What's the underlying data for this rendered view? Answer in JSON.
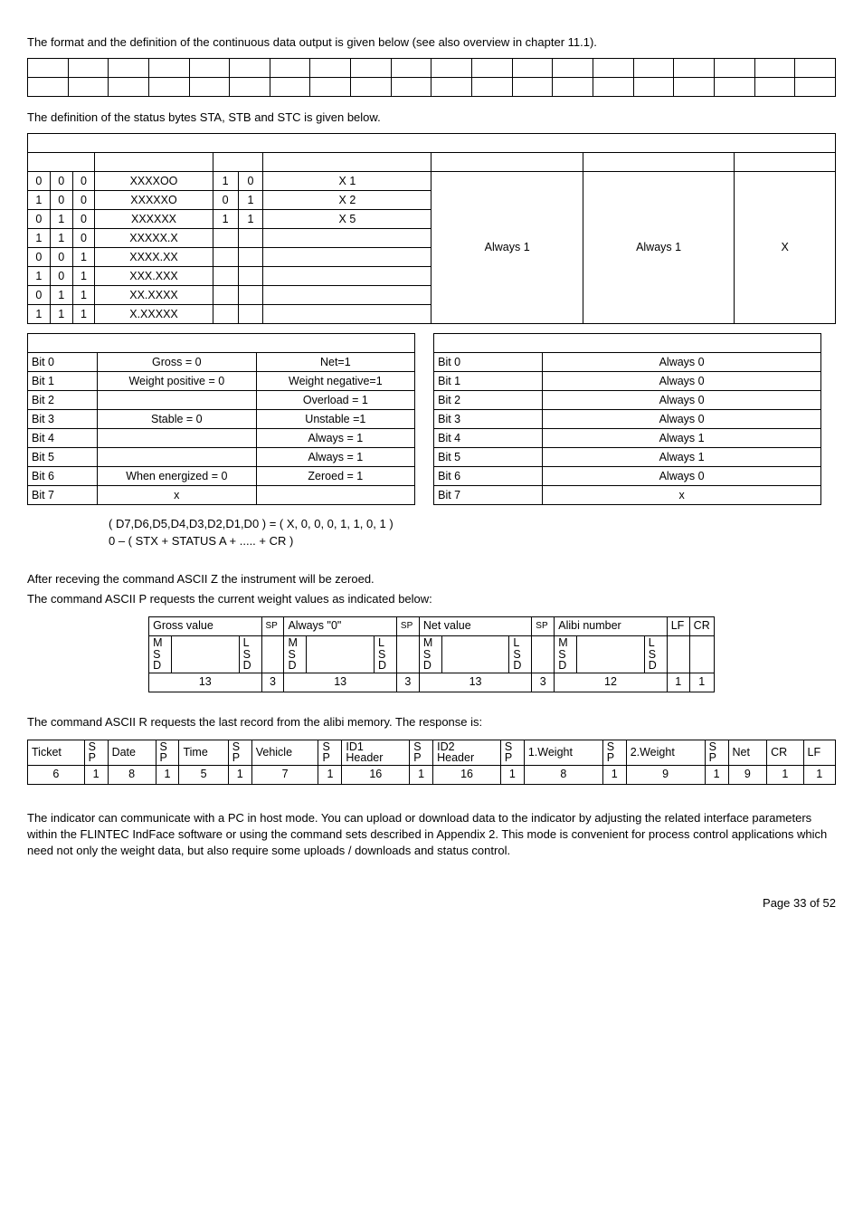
{
  "intro1": "The format and the definition of the continuous data output is given below (see also overview in chapter 11.1).",
  "intro2": "The definition of the status bytes STA, STB and STC is given below.",
  "status_rows": [
    [
      "0",
      "0",
      "0",
      "XXXXOO",
      "1",
      "0",
      "X 1"
    ],
    [
      "1",
      "0",
      "0",
      "XXXXXO",
      "0",
      "1",
      "X 2"
    ],
    [
      "0",
      "1",
      "0",
      "XXXXXX",
      "1",
      "1",
      "X 5"
    ],
    [
      "1",
      "1",
      "0",
      "XXXXX.X",
      "",
      "",
      ""
    ],
    [
      "0",
      "0",
      "1",
      "XXXX.XX",
      "",
      "",
      ""
    ],
    [
      "1",
      "0",
      "1",
      "XXX.XXX",
      "",
      "",
      ""
    ],
    [
      "0",
      "1",
      "1",
      "XX.XXXX",
      "",
      "",
      ""
    ],
    [
      "1",
      "1",
      "1",
      "X.XXXXX",
      "",
      "",
      ""
    ]
  ],
  "status_right": {
    "a": "Always 1",
    "b": "Always 1",
    "c": "X"
  },
  "bits_left": [
    [
      "Bit  0",
      "Gross = 0",
      "Net=1"
    ],
    [
      "Bit  1",
      "Weight positive = 0",
      "Weight negative=1"
    ],
    [
      "Bit  2",
      "",
      "Overload = 1"
    ],
    [
      "Bit  3",
      "Stable = 0",
      "Unstable =1"
    ],
    [
      "Bit  4",
      "",
      "Always = 1"
    ],
    [
      "Bit  5",
      "",
      "Always = 1"
    ],
    [
      "Bit  6",
      "When energized = 0",
      "Zeroed = 1"
    ],
    [
      "Bit  7",
      "x",
      ""
    ]
  ],
  "bits_right": [
    [
      "Bit  0",
      "Always  0"
    ],
    [
      "Bit  1",
      "Always  0"
    ],
    [
      "Bit  2",
      "Always  0"
    ],
    [
      "Bit  3",
      "Always  0"
    ],
    [
      "Bit  4",
      "Always  1"
    ],
    [
      "Bit  5",
      "Always  1"
    ],
    [
      "Bit  6",
      "Always  0"
    ],
    [
      "Bit  7",
      "x"
    ]
  ],
  "formula1": "( D7,D6,D5,D4,D3,D2,D1,D0 )  =  (  X, 0, 0, 0, 1, 1, 0, 1 )",
  "formula2": "0 – (  STX +  STATUS  A  +  ..... +  CR  )",
  "after1": "After receving the command ASCII Z the instrument will be zeroed.",
  "after2": "The command ASCII P requests the current weight values as indicated below:",
  "req_headers": [
    "Gross value",
    "SP",
    "Always \"0\"",
    "SP",
    "Net value",
    "SP",
    "Alibi number",
    "LF",
    "CR"
  ],
  "req_msd": "M\nS\nD",
  "req_lsd": "L\nS\nD",
  "req_data": [
    "13",
    "3",
    "13",
    "3",
    "13",
    "3",
    "12",
    "1",
    "1"
  ],
  "resp_intro": "The command  ASCII R  requests the last record from the alibi memory. The response is:",
  "resp_headers": [
    "Ticket",
    "S\nP",
    "Date",
    "S\nP",
    "Time",
    "S\nP",
    "Vehicle",
    "S\nP",
    "ID1\nHeader",
    "S\nP",
    "ID2\nHeader",
    "S\nP",
    "1.Weight",
    "S\nP",
    "2.Weight",
    "S\nP",
    "Net",
    "CR",
    "LF"
  ],
  "resp_data": [
    "6",
    "1",
    "8",
    "1",
    "5",
    "1",
    "7",
    "1",
    "16",
    "1",
    "16",
    "1",
    "8",
    "1",
    "9",
    "1",
    "9",
    "1",
    "1"
  ],
  "footer": "The indicator can communicate with a PC in host mode. You can upload or download data to the indicator by adjusting the related interface parameters within the FLINTEC IndFace software or using the command sets described in Appendix 2. This mode is convenient for process control applications which need not only the weight data, but also require some uploads / downloads and status control.",
  "pagenum": "Page 33 of 52"
}
